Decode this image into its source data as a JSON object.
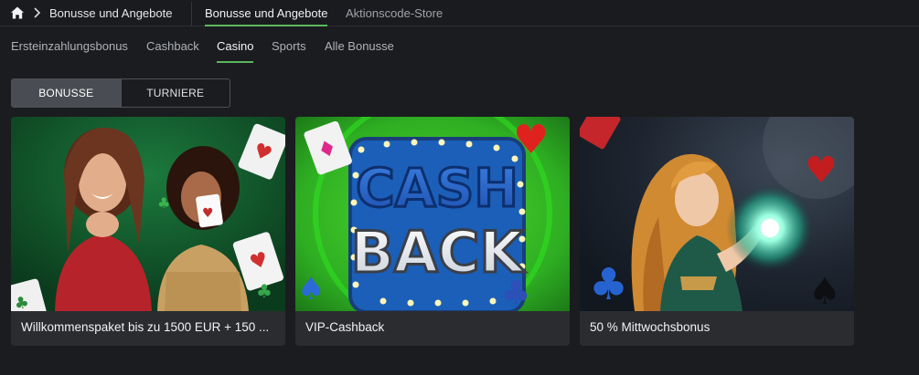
{
  "breadcrumb": {
    "label": "Bonusse und Angebote"
  },
  "top_tabs": [
    {
      "label": "Bonusse und Angebote",
      "active": true
    },
    {
      "label": "Aktionscode-Store",
      "active": false
    }
  ],
  "sub_tabs": [
    {
      "label": "Ersteinzahlungsbonus"
    },
    {
      "label": "Cashback"
    },
    {
      "label": "Casino",
      "active": true
    },
    {
      "label": "Sports"
    },
    {
      "label": "Alle Bonusse"
    }
  ],
  "toggle": {
    "left": "BONUSSE",
    "right": "TURNIERE",
    "selected": "BONUSSE"
  },
  "cards": [
    {
      "title": "Willkommenspaket bis zu 1500 EUR + 150 ...",
      "image": "casino-dealers-image"
    },
    {
      "title": "VIP-Cashback",
      "image": "cash-back-sign-image",
      "image_text": [
        "CASH",
        "BACK"
      ]
    },
    {
      "title": "50 % Mittwochsbonus",
      "image": "sorceress-with-orb-image"
    }
  ],
  "colors": {
    "accent": "#5cb85c",
    "background": "#1b1c1f",
    "card": "#2a2c30"
  }
}
